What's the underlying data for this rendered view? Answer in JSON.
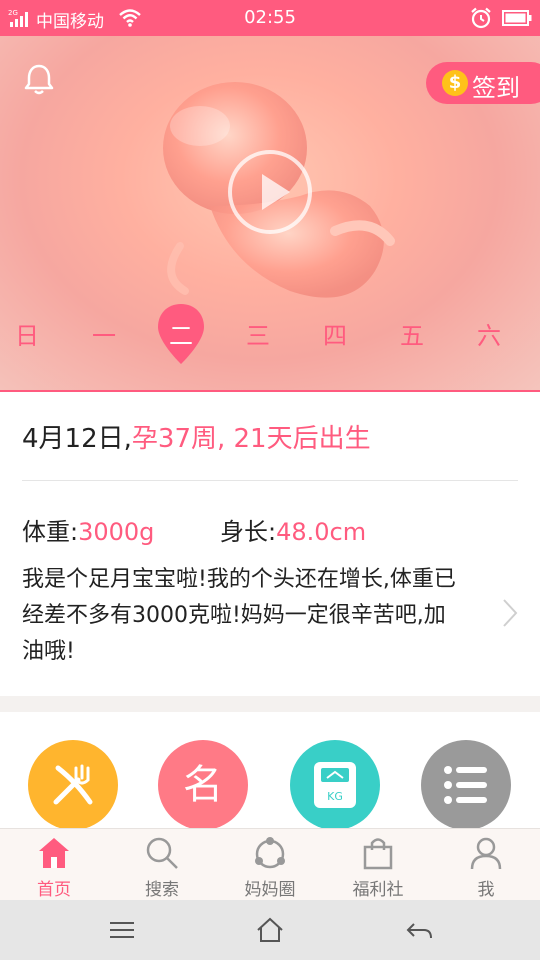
{
  "status_bar": {
    "network": "2G",
    "carrier": "中国移动",
    "time": "02:55"
  },
  "hero": {
    "checkin_label": "签到",
    "coin_symbol": "$",
    "week_days": [
      "日",
      "一",
      "二",
      "三",
      "四",
      "五",
      "六"
    ],
    "selected_day_index": 2
  },
  "info": {
    "date": "4月12日,",
    "pregnancy_status": "孕37周, 21天后出生",
    "weight_label": "体重:",
    "weight_value": "3000g",
    "length_label": "身长:",
    "length_value": "48.0cm",
    "description": "我是个足月宝宝啦!我的个头还在增长,体重已经差不多有3000克啦!妈妈一定很辛苦吧,加油哦!"
  },
  "tools": {
    "name_tool_char": "名",
    "scale_unit": "KG"
  },
  "tabbar": {
    "items": [
      {
        "label": "首页",
        "icon": "home-icon",
        "active": true
      },
      {
        "label": "搜索",
        "icon": "search-icon",
        "active": false
      },
      {
        "label": "妈妈圈",
        "icon": "community-icon",
        "active": false
      },
      {
        "label": "福利社",
        "icon": "shopping-bag-icon",
        "active": false
      },
      {
        "label": "我",
        "icon": "person-icon",
        "active": false
      }
    ]
  },
  "colors": {
    "accent": "#ff5b7f",
    "coin": "#ffc21a",
    "tool_orange": "#ffb52e",
    "tool_pink": "#ff7a86",
    "tool_teal": "#39cfc7",
    "tool_gray": "#9a9a9a"
  }
}
